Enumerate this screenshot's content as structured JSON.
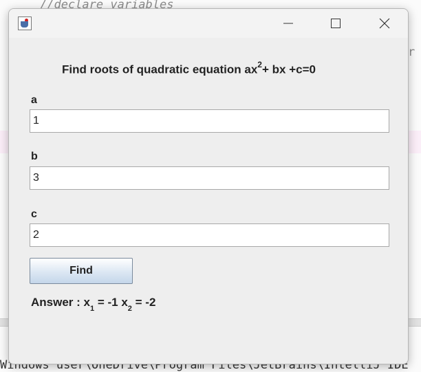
{
  "background": {
    "code_comment": "//declare variables",
    "code_right_fragment": "r",
    "status_fragment": "Windows user\\OneDrive\\Program Files\\JetBrains\\IntelliJ IDE"
  },
  "window": {
    "minimize_glyph": "—",
    "maximize_glyph": "☐",
    "close_glyph": "✕"
  },
  "form": {
    "heading_prefix": "Find roots of quadratic equation ax",
    "heading_exponent": "2",
    "heading_suffix": "+ bx +c=0",
    "label_a": "a",
    "value_a": "1",
    "label_b": "b",
    "value_b": "3",
    "label_c": "c",
    "value_c": "2",
    "find_label": "Find"
  },
  "answer": {
    "prefix": "Answer : x",
    "sub1": "1",
    "mid": " = -1 x",
    "sub2": "2",
    "suffix": " = -2"
  }
}
